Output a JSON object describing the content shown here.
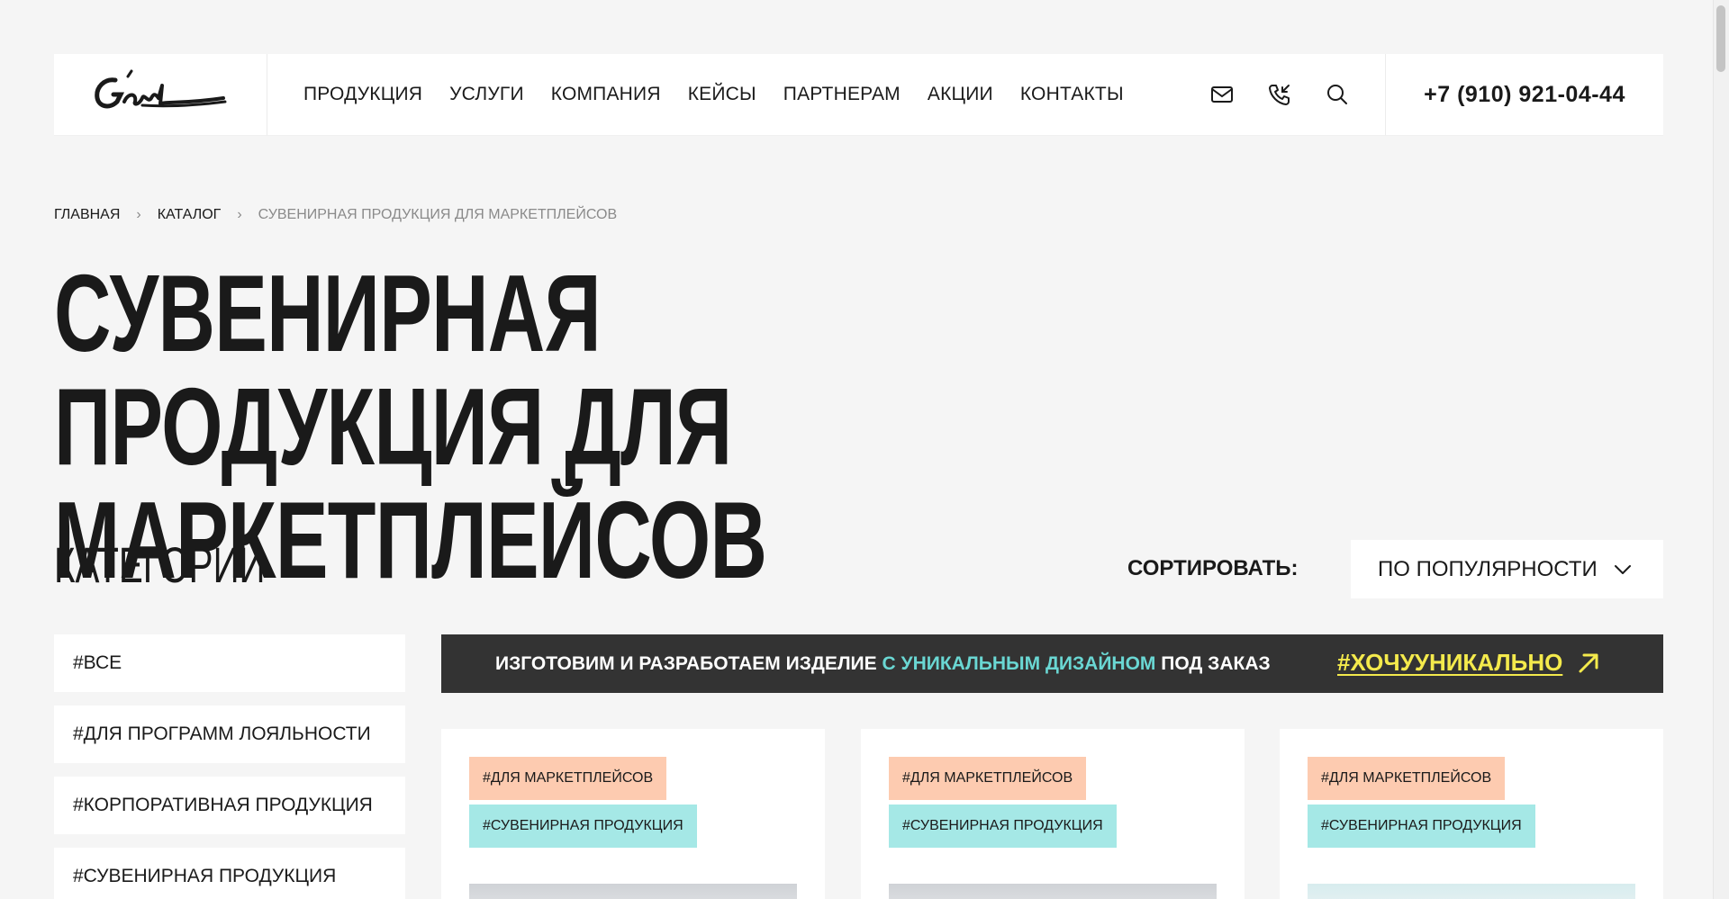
{
  "header": {
    "logo_alt": "G'ant",
    "nav": [
      {
        "label": "ПРОДУКЦИЯ"
      },
      {
        "label": "УСЛУГИ"
      },
      {
        "label": "КОМПАНИЯ"
      },
      {
        "label": "КЕЙСЫ"
      },
      {
        "label": "ПАРТНЕРАМ"
      },
      {
        "label": "АКЦИИ"
      },
      {
        "label": "КОНТАКТЫ"
      }
    ],
    "icons": [
      "mail-icon",
      "phone-callback-icon",
      "search-icon"
    ],
    "phone": "+7 (910) 921-04-44"
  },
  "breadcrumb": {
    "items": [
      "ГЛАВНАЯ",
      "КАТАЛОГ",
      "СУВЕНИРНАЯ ПРОДУКЦИЯ ДЛЯ МАРКЕТПЛЕЙСОВ"
    ]
  },
  "page": {
    "title_line1": "СУВЕНИРНАЯ ПРОДУКЦИЯ ДЛЯ",
    "title_line2": "МАРКЕТПЛЕЙСОВ"
  },
  "categories": {
    "heading": "КАТЕГОРИИ",
    "items": [
      {
        "label": "#ВСЕ"
      },
      {
        "label": "#ДЛЯ ПРОГРАММ ЛОЯЛЬНОСТИ"
      },
      {
        "label": "#КОРПОРАТИВНАЯ ПРОДУКЦИЯ"
      },
      {
        "label": "#СУВЕНИРНАЯ ПРОДУКЦИЯ"
      }
    ]
  },
  "sort": {
    "label": "СОРТИРОВАТЬ:",
    "value": "ПО ПОПУЛЯРНОСТИ"
  },
  "banner": {
    "text_before": "ИЗГОТОВИМ И РАЗРАБОТАЕМ ИЗДЕЛИЕ ",
    "text_accent": "С УНИКАЛЬНЫМ ДИЗАЙНОМ",
    "text_after": " ПОД ЗАКАЗ",
    "link": "#ХОЧУУНИКАЛЬНО"
  },
  "products": [
    {
      "tags": [
        "#ДЛЯ МАРКЕТПЛЕЙСОВ",
        "#СУВЕНИРНАЯ ПРОДУКЦИЯ"
      ]
    },
    {
      "tags": [
        "#ДЛЯ МАРКЕТПЛЕЙСОВ",
        "#СУВЕНИРНАЯ ПРОДУКЦИЯ"
      ]
    },
    {
      "tags": [
        "#ДЛЯ МАРКЕТПЛЕЙСОВ",
        "#СУВЕНИРНАЯ ПРОДУКЦИЯ"
      ]
    }
  ],
  "colors": {
    "background": "#f5f5f5",
    "banner_bg": "#333333",
    "banner_accent": "#6ad7d3",
    "banner_link": "#f4ea4c",
    "tag_peach": "#fdcbb0",
    "tag_cyan": "#a5e8e6"
  }
}
